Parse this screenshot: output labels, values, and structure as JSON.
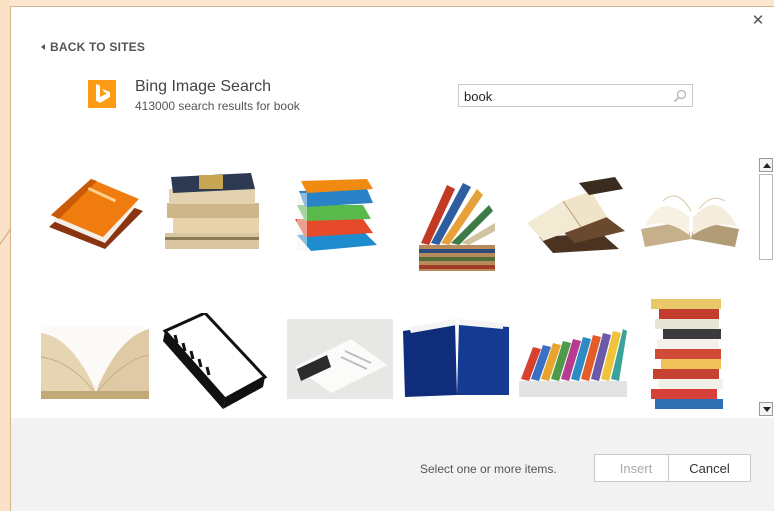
{
  "nav": {
    "back_label": "BACK TO SITES"
  },
  "provider": {
    "name": "Bing Image Search",
    "results_text": "413000 search results for book",
    "brand_color": "#ff9a15"
  },
  "search": {
    "value": "book"
  },
  "results": [
    {
      "name": "orange hardcover book"
    },
    {
      "name": "stack of old books"
    },
    {
      "name": "stack of colorful books"
    },
    {
      "name": "fanned book stack"
    },
    {
      "name": "open books pile"
    },
    {
      "name": "open book pages"
    },
    {
      "name": "open book closeup"
    },
    {
      "name": "book line art"
    },
    {
      "name": "white booklet"
    },
    {
      "name": "blue open book"
    },
    {
      "name": "row of leaning books"
    },
    {
      "name": "tall book stack"
    }
  ],
  "footer": {
    "status": "Select one or more items.",
    "insert_label": "Insert",
    "cancel_label": "Cancel"
  },
  "icons": {
    "close": "close-icon",
    "search": "search-icon",
    "back": "chevron-left-icon",
    "logo": "bing-logo-icon"
  }
}
